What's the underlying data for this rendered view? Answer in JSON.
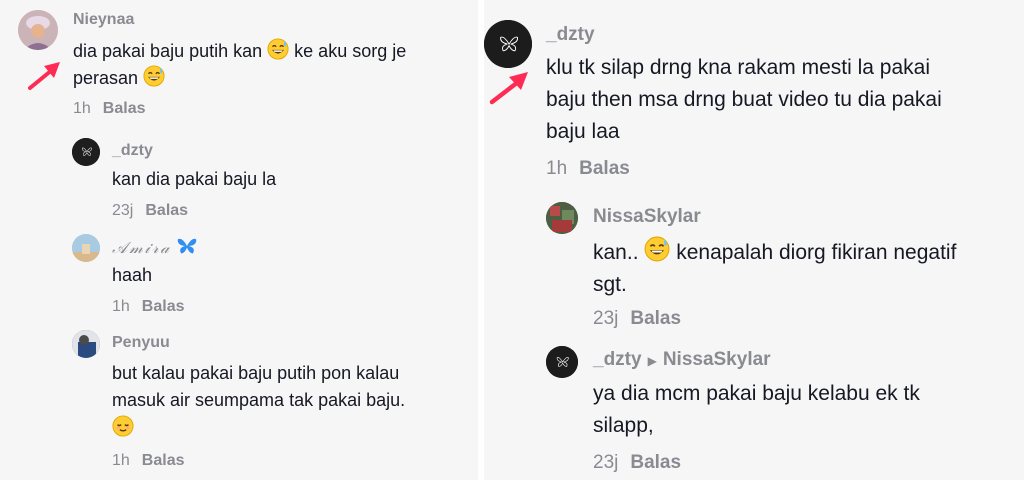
{
  "left": {
    "main": {
      "username": "Nieynaa",
      "text1": "dia pakai baju putih kan",
      "text2": "ke aku sorg je",
      "text3": "perasan",
      "time": "1h",
      "reply": "Balas"
    },
    "replies": [
      {
        "username": "_dzty",
        "text": "kan dia pakai baju la",
        "time": "23j",
        "reply": "Balas"
      },
      {
        "username": "𝒜𝓂𝒾𝓇𝒶",
        "text": "haah",
        "time": "1h",
        "reply": "Balas"
      },
      {
        "username": "Penyuu",
        "text1": "but kalau pakai baju putih pon kalau",
        "text2": "masuk air seumpama tak pakai baju.",
        "time": "1h",
        "reply": "Balas"
      }
    ]
  },
  "right": {
    "main": {
      "username": "_dzty",
      "line1": "klu tk silap drng kna rakam mesti la pakai",
      "line2": "baju then msa drng buat video tu dia pakai",
      "line3": "baju laa",
      "time": "1h",
      "reply": "Balas"
    },
    "replies": [
      {
        "username": "NissaSkylar",
        "text1": "kan..",
        "text2": "kenapalah diorg fikiran negatif",
        "text3": "sgt.",
        "time": "23j",
        "reply": "Balas"
      },
      {
        "username": "_dzty",
        "reply_to": "NissaSkylar",
        "line1": "ya dia mcm pakai baju kelabu ek tk",
        "line2": "silapp,",
        "time": "23j",
        "reply": "Balas"
      }
    ]
  },
  "icons": {
    "grin_sweat": "grinning-face-with-sweat-emoji",
    "relieved": "relieved-face-emoji",
    "butterfly": "blue-butterfly-emoji",
    "arrow": "pink-arrow"
  },
  "colors": {
    "background": "#f6f6f7",
    "text": "#161823",
    "muted": "#8a8b91",
    "arrow": "#fe2c55"
  }
}
